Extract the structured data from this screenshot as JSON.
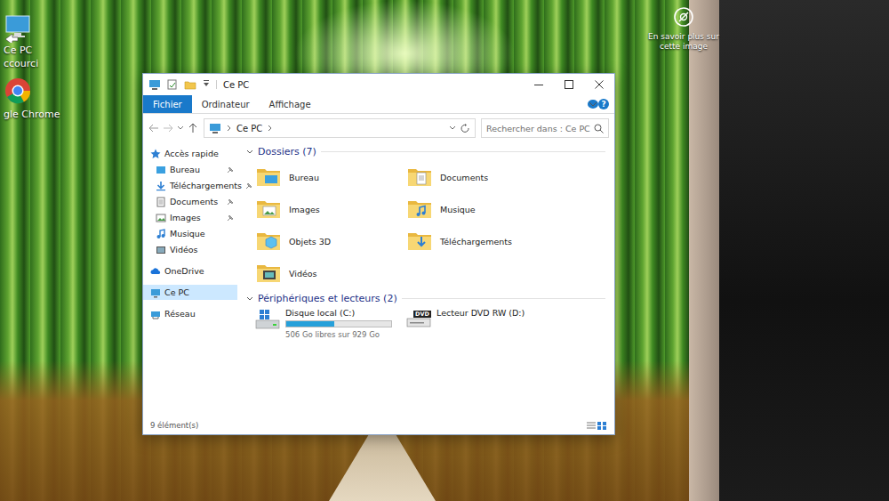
{
  "desktop": {
    "icons": [
      {
        "lines": [
          "Ce PC",
          "ccourci"
        ]
      },
      {
        "lines": [
          "gle Chrome"
        ]
      }
    ],
    "spotlight": {
      "label": "En savoir plus sur cette image"
    }
  },
  "window": {
    "title": "Ce PC",
    "tabs": [
      {
        "label": "Fichier",
        "selected": true
      },
      {
        "label": "Ordinateur",
        "selected": false
      },
      {
        "label": "Affichage",
        "selected": false
      }
    ],
    "help": "?",
    "address": {
      "path": "Ce PC"
    },
    "search": {
      "placeholder": "Rechercher dans : Ce PC"
    }
  },
  "sidebar": {
    "items": [
      {
        "label": "Accès rapide",
        "kind": "group",
        "selected": false,
        "pinned": false
      },
      {
        "label": "Bureau",
        "kind": "child",
        "selected": false,
        "pinned": true
      },
      {
        "label": "Téléchargements",
        "kind": "child",
        "selected": false,
        "pinned": true
      },
      {
        "label": "Documents",
        "kind": "child",
        "selected": false,
        "pinned": true
      },
      {
        "label": "Images",
        "kind": "child",
        "selected": false,
        "pinned": true
      },
      {
        "label": "Musique",
        "kind": "child",
        "selected": false,
        "pinned": false
      },
      {
        "label": "Vidéos",
        "kind": "child",
        "selected": false,
        "pinned": false
      },
      {
        "label": "OneDrive",
        "kind": "group",
        "selected": false,
        "pinned": false
      },
      {
        "label": "Ce PC",
        "kind": "group",
        "selected": true,
        "pinned": false
      },
      {
        "label": "Réseau",
        "kind": "group",
        "selected": false,
        "pinned": false
      }
    ]
  },
  "folders": {
    "header": "Dossiers (7)",
    "items": [
      "Bureau",
      "Images",
      "Objets 3D",
      "Vidéos",
      "Documents",
      "Musique",
      "Téléchargements"
    ]
  },
  "drives": {
    "header": "Périphériques et lecteurs (2)",
    "items": [
      {
        "name": "Disque local (C:)",
        "kind": "disk",
        "level": 0.46,
        "reading": "506 Go libres sur 929 Go"
      },
      {
        "name": "Lecteur DVD RW (D:)",
        "kind": "dvd",
        "badge": "DVD"
      }
    ]
  },
  "status_bar": {
    "count": "9 élément(s)"
  }
}
